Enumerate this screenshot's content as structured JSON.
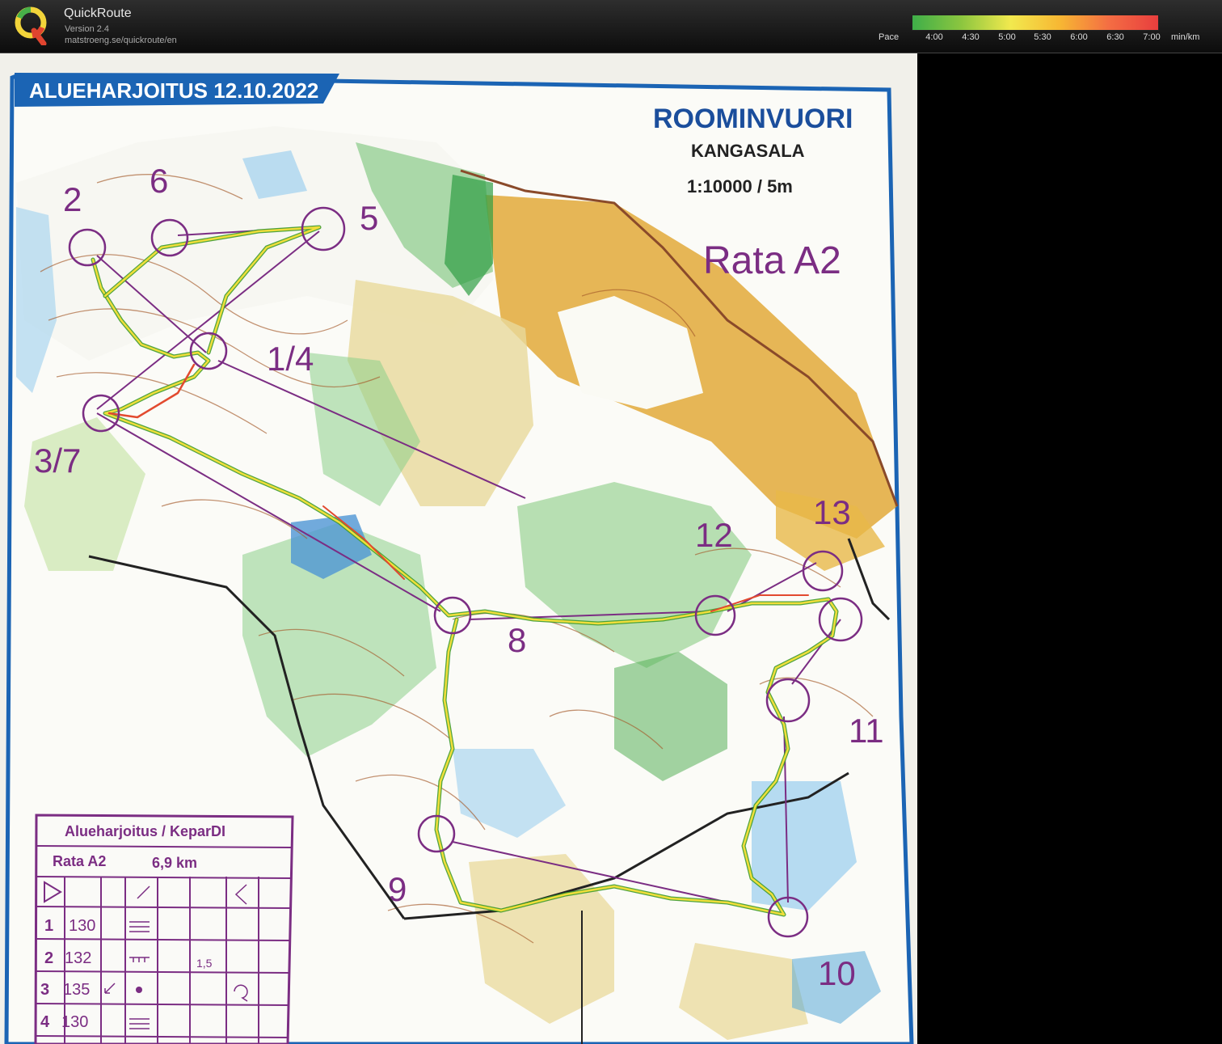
{
  "app": {
    "name": "QuickRoute",
    "version": "Version 2.4",
    "url": "matstroeng.se/quickroute/en"
  },
  "pace_legend": {
    "label": "Pace",
    "ticks": [
      "4:00",
      "4:30",
      "5:00",
      "5:30",
      "6:00",
      "6:30",
      "7:00"
    ],
    "unit": "min/km",
    "colors": [
      "#3fae49",
      "#8cc63f",
      "#f2e94e",
      "#f7b733",
      "#f46d43",
      "#e83e3e"
    ]
  },
  "map": {
    "header_title": "ALUEHARJOITUS 12.10.2022",
    "area_name": "ROOMINVUORI",
    "municipality": "KANGASALA",
    "scale": "1:10000 / 5m",
    "course_title": "Rata A2",
    "control_numbers": [
      "2",
      "6",
      "5",
      "1/4",
      "3/7",
      "8",
      "12",
      "13",
      "11",
      "9",
      "10"
    ],
    "course_color": "#7b2d83",
    "description_table": {
      "title": "Alueharjoitus / KeparDI",
      "course": "Rata A2",
      "length": "6,9 km",
      "rows": [
        {
          "num": "1",
          "code": "130"
        },
        {
          "num": "2",
          "code": "132"
        },
        {
          "num": "3",
          "code": "135"
        },
        {
          "num": "4",
          "code": "130"
        }
      ],
      "note": "1,5"
    }
  }
}
